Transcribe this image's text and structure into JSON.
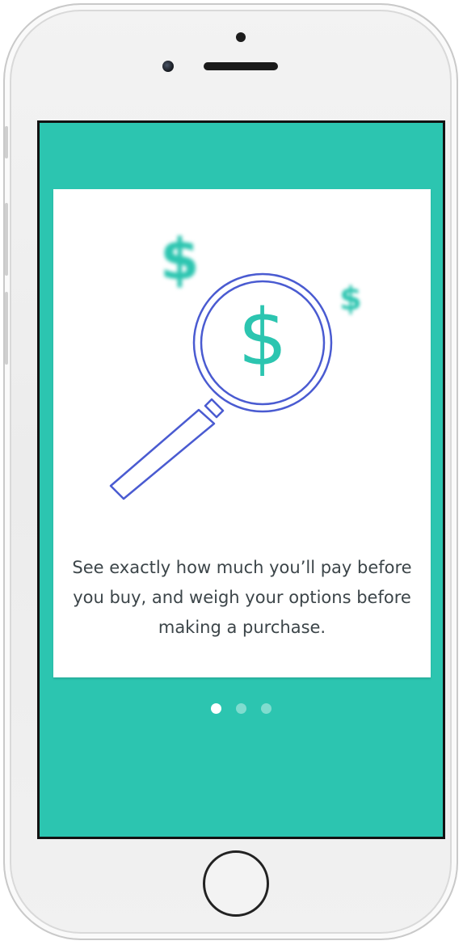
{
  "onboarding": {
    "message": "See exactly how much you’ll pay before you buy, and weigh your options before making a purchase.",
    "icons": {
      "decor_big": "$",
      "decor_small": "$",
      "lens": "$"
    },
    "illustration_icon": "magnifying-glass-dollar-icon",
    "pagination": {
      "total": 3,
      "active_index": 0
    }
  },
  "colors": {
    "accent": "#2cc5b0",
    "outline": "#4a5bd1",
    "text": "#3c4549"
  }
}
